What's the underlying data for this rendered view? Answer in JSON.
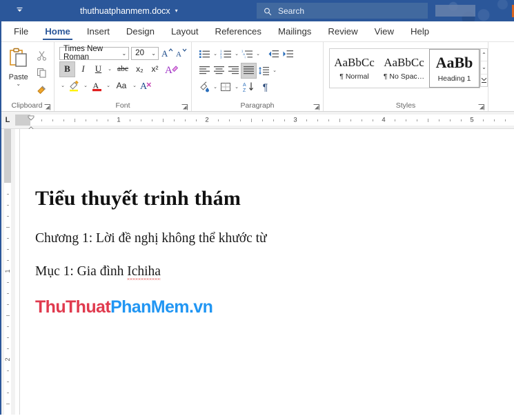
{
  "titlebar": {
    "qat_icon": "customize-quick-access-chevron",
    "document_name": "thuthuatphanmem.docx",
    "dropdown_caret": "▾",
    "search": {
      "placeholder": "Search",
      "icon": "search-icon"
    }
  },
  "tabs": [
    {
      "label": "File",
      "active": false
    },
    {
      "label": "Home",
      "active": true
    },
    {
      "label": "Insert",
      "active": false
    },
    {
      "label": "Design",
      "active": false
    },
    {
      "label": "Layout",
      "active": false
    },
    {
      "label": "References",
      "active": false
    },
    {
      "label": "Mailings",
      "active": false
    },
    {
      "label": "Review",
      "active": false
    },
    {
      "label": "View",
      "active": false
    },
    {
      "label": "Help",
      "active": false
    }
  ],
  "ribbon": {
    "clipboard": {
      "group_label": "Clipboard",
      "paste_label": "Paste",
      "paste_caret": "⌄",
      "cut_icon": "scissors-icon",
      "copy_icon": "copy-icon",
      "format_painter_icon": "format-painter-icon",
      "dialog_launcher": "◺"
    },
    "font": {
      "group_label": "Font",
      "font_name": "Times New Roman",
      "font_size": "20",
      "caret": "⌄",
      "bold": "B",
      "italic": "I",
      "underline": "U",
      "strikethrough": "abc",
      "subscript": "x₂",
      "superscript": "x²",
      "clear_formatting": "clear-formatting-icon",
      "text_effects": "text-effects-icon",
      "highlight": "highlight-icon",
      "font_color": "A",
      "change_case": "Aa",
      "grow_font": "A",
      "shrink_font": "A",
      "dialog_launcher": "◺"
    },
    "paragraph": {
      "group_label": "Paragraph",
      "bullets": "bullets-icon",
      "numbering": "numbering-icon",
      "multilevel": "multilevel-list-icon",
      "decrease_indent": "decrease-indent-icon",
      "increase_indent": "increase-indent-icon",
      "align_left": "align-left-icon",
      "align_center": "align-center-icon",
      "align_right": "align-right-icon",
      "justify": "justify-icon",
      "justify_active": true,
      "line_spacing": "line-spacing-icon",
      "shading": "shading-icon",
      "borders": "borders-icon",
      "sort": "sort-icon",
      "show_marks": "¶",
      "dialog_launcher": "◺"
    },
    "styles": {
      "group_label": "Styles",
      "items": [
        {
          "preview": "AaBbCc",
          "name": "¶ Normal",
          "selected": false,
          "heading": false
        },
        {
          "preview": "AaBbCc",
          "name": "¶ No Spac…",
          "selected": false,
          "heading": false
        },
        {
          "preview": "AaBb",
          "name": "Heading 1",
          "selected": true,
          "heading": true
        }
      ],
      "scroll_up": "⌃",
      "scroll_down": "⌄",
      "more": "≡"
    }
  },
  "ruler": {
    "tab_selector": "L",
    "horizontal_numbers": [
      "1",
      "2",
      "3",
      "4",
      "5"
    ],
    "vertical_numbers": [
      "1",
      "2"
    ]
  },
  "document": {
    "heading": "Tiểu thuyết trinh thám",
    "paragraph_1": "Chương 1: Lời đề nghị không thể khước từ",
    "paragraph_2_before": "Mục 1: Gia đình ",
    "paragraph_2_misspelled": "Ichiha",
    "watermark": {
      "red_part_1": "Thu",
      "red_part_2": "Thuat",
      "blue_part": "PhanMem.vn",
      "red_color": "#e03a4e",
      "blue_color": "#2196f3"
    }
  },
  "colors": {
    "titlebar": "#2b579a",
    "accent": "#2b579a",
    "ribbon_bg": "#ffffff",
    "ruler_bg": "#f2f2f2"
  }
}
